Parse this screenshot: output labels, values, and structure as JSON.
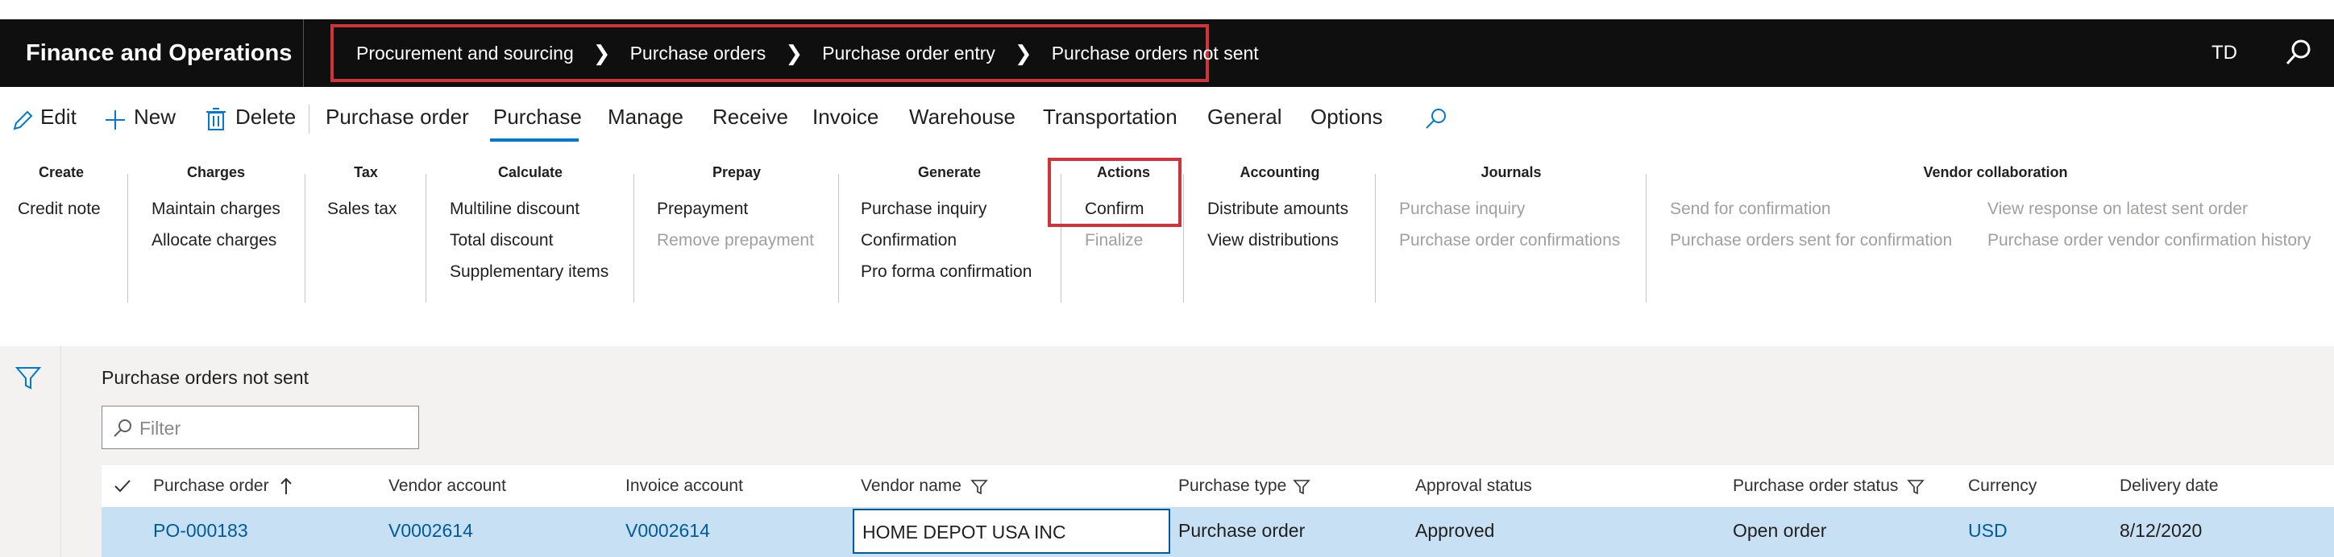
{
  "app": {
    "title": "Finance and Operations",
    "user_initials": "TD"
  },
  "breadcrumb": [
    "Procurement and sourcing",
    "Purchase orders",
    "Purchase order entry",
    "Purchase orders not sent"
  ],
  "ribbon": {
    "edit": "Edit",
    "new": "New",
    "delete": "Delete",
    "tabs": [
      "Purchase order",
      "Purchase",
      "Manage",
      "Receive",
      "Invoice",
      "Warehouse",
      "Transportation",
      "General",
      "Options"
    ],
    "active_tab": "Purchase"
  },
  "groups": {
    "create": {
      "title": "Create",
      "items": [
        "Credit note"
      ]
    },
    "charges": {
      "title": "Charges",
      "items": [
        "Maintain charges",
        "Allocate charges"
      ]
    },
    "tax": {
      "title": "Tax",
      "items": [
        "Sales tax"
      ]
    },
    "calculate": {
      "title": "Calculate",
      "items": [
        "Multiline discount",
        "Total discount",
        "Supplementary items"
      ]
    },
    "prepay": {
      "title": "Prepay",
      "items": [
        "Prepayment",
        "Remove prepayment"
      ]
    },
    "generate": {
      "title": "Generate",
      "items": [
        "Purchase inquiry",
        "Confirmation",
        "Pro forma confirmation"
      ]
    },
    "actions": {
      "title": "Actions",
      "items": [
        "Confirm",
        "Finalize"
      ]
    },
    "accounting": {
      "title": "Accounting",
      "items": [
        "Distribute amounts",
        "View distributions"
      ]
    },
    "journals": {
      "title": "Journals",
      "items": [
        "Purchase inquiry",
        "Purchase order confirmations"
      ]
    },
    "vendor_collaboration": {
      "title": "Vendor collaboration",
      "items": [
        "Send for confirmation",
        "Purchase orders sent for confirmation",
        "View response on latest sent order",
        "Purchase order vendor confirmation history"
      ]
    }
  },
  "page": {
    "title": "Purchase orders not sent",
    "filter_placeholder": "Filter"
  },
  "grid": {
    "columns": [
      "Purchase order",
      "Vendor account",
      "Invoice account",
      "Vendor name",
      "Purchase type",
      "Approval status",
      "Purchase order status",
      "Currency",
      "Delivery date"
    ],
    "rows": [
      [
        "PO-000183",
        "V0002614",
        "V0002614",
        "HOME DEPOT USA INC",
        "Purchase order",
        "Approved",
        "Open order",
        "USD",
        "8/12/2020"
      ]
    ]
  },
  "colors": {
    "accent": "#0078d4",
    "highlight_border": "#d13438",
    "selected_row": "#c7e0f4",
    "topbar": "#0f0f0f"
  }
}
